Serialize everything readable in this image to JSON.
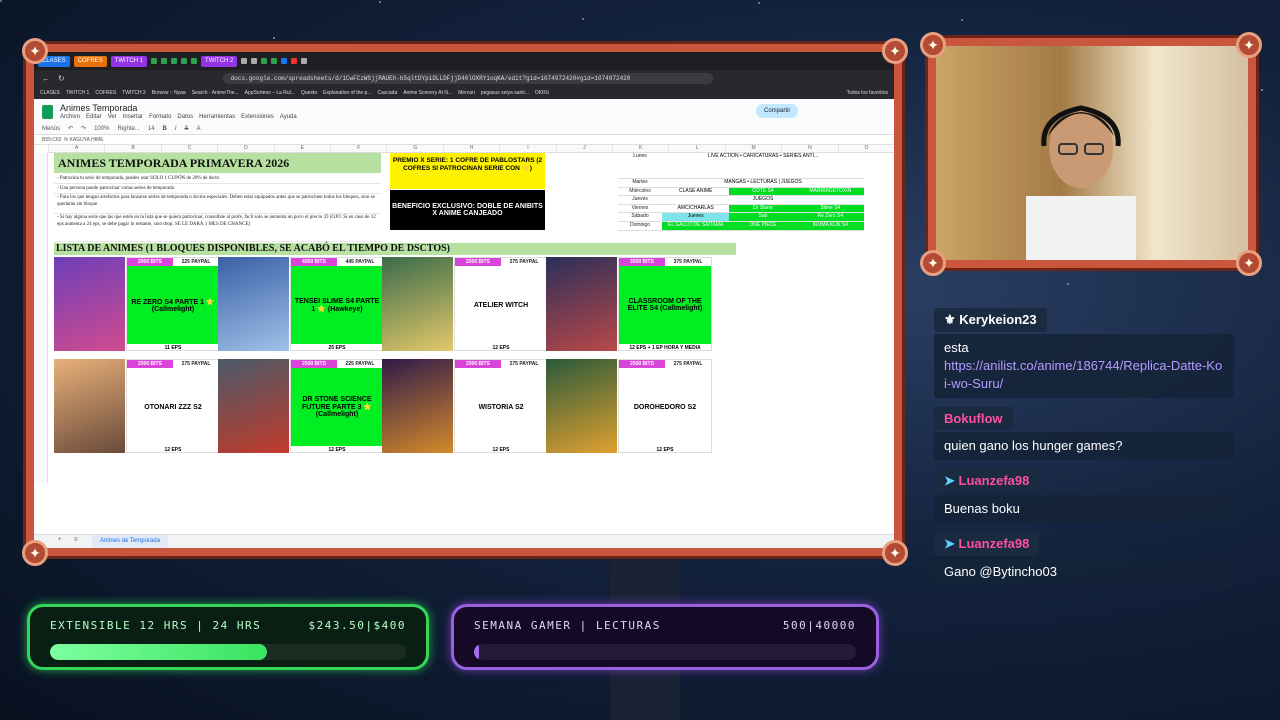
{
  "browser": {
    "tabs": [
      "CLASES",
      "COFRES",
      "TWITCH 1",
      "TWITCH 2"
    ],
    "url": "docs.google.com/spreadsheets/d/1CwFCzWSjjRAUEh-b5qltDYpiDLLDFjjD40lOXRYioqKA/edit?gid=1074972420#gid=1074972420",
    "bookmarks": [
      "CLASES",
      "TWITCH 1",
      "COFRES",
      "TWITCH 2",
      "Browse :: Nyaa",
      "Search - AnimeThe...",
      "AppSorteos – La Rul...",
      "Questo",
      "Explanation of the p...",
      "Cascada",
      "Anime Scenery At N...",
      "Mercari",
      "pegasus seiya saint...",
      "OKRU",
      "Todos los favoritos"
    ]
  },
  "sheet": {
    "doc_title": "Animes Temporada",
    "menu": [
      "Archivo",
      "Editar",
      "Ver",
      "Insertar",
      "Formato",
      "Datos",
      "Herramientas",
      "Extensiones",
      "Ayuda"
    ],
    "share_label": "Compartir",
    "toolbar": {
      "menus": "Menús",
      "zoom": "100%",
      "font": "Righte...",
      "size": "14"
    },
    "cell_ref": "B55:C62",
    "formula": "KAGUYA HIME",
    "columns": [
      "A",
      "B",
      "C",
      "D",
      "E",
      "F",
      "G",
      "H",
      "I",
      "J",
      "K",
      "L",
      "M",
      "N",
      "O"
    ],
    "title": "ANIMES TEMPORADA PRIMAVERA 2026",
    "rules": [
      "- Patrocina tu serie de temporada, puedes usar SOLO 1 CUPÓN de 20% de dscto",
      "- Una persona puede patrocinar varias series de temporada",
      "- Para los que tengan artefactos para lanzarse series de temporada o dsctos especiales. Deben estar equipados antes que se patrocinen todos los bloques, sino se quedarán sin bloque",
      "- Si hay alguna serie que las que estén en la lista que se quiera patrocinar, consultale al profe, facil solo se aumenta un poco el precio :D (OJO: Si en caso de 12 eps aumenta a 24 eps, se debe pagar lo restante, sino drop. SE LE DARÁ 1 MES DE CHANCE)"
    ],
    "premio": "PREMIO X SERIE: 1 COFRE DE PABLOSTARS (2 COFRES SI PATROCINAN SERIE CON ⭐)",
    "beneficio": "BENEFICIO EXCLUSIVO: DOBLE DE ANIBITS X ANIME CANJEADO",
    "schedule": [
      {
        "day": "Lunes",
        "cols": [
          "LIVE ACTION • CARICATURAS • SERIES ANTI..."
        ]
      },
      {
        "day": "Martes",
        "cols": [
          "MANGAS • LECTURAS | JUEGOS"
        ]
      },
      {
        "day": "Miércoles",
        "cols": [
          "CLASE ANIME",
          "COTE S4",
          "MARRIAGETOXIN"
        ]
      },
      {
        "day": "Jueves",
        "cols": [
          "JUEGOS"
        ]
      },
      {
        "day": "Viernes",
        "cols": [
          "AMC/CHARLAS",
          "Dr Stone",
          "Slime S4"
        ]
      },
      {
        "day": "Sábado",
        "cols": [
          "Jueves",
          "Sab",
          "Re Zero S4"
        ]
      },
      {
        "day": "Domingo",
        "cols": [
          "EL GALLO DE SAITAMA",
          "ONE PIECE",
          "IRUMA KUN S4"
        ]
      }
    ],
    "list_header": "LISTA DE ANIMES (1 BLOQUES DISPONIBLES, SE ACABÓ EL TIEMPO DE DSCTOS)",
    "animes": [
      {
        "bits": "2000 BITS",
        "paypal": "225 PAYPAL",
        "name": "RE ZERO S4 PARTE 1 ⭐ (Callmelight)",
        "eps": "11 EPS",
        "taken": true,
        "poster": [
          "#6d3fb8",
          "#d14b8f"
        ]
      },
      {
        "bits": "4000 BITS",
        "paypal": "445 PAYPAL",
        "name": "TENSEI SLIME S4 PARTE 1 ⭐ (Hawkeye)",
        "eps": "25 EPS",
        "taken": true,
        "poster": [
          "#3b5fa6",
          "#9fc2e8"
        ]
      },
      {
        "bits": "2500 BITS",
        "paypal": "275 PAYPAL",
        "name": "ATELIER WITCH",
        "eps": "12 EPS",
        "taken": false,
        "poster": [
          "#3a6b4a",
          "#e3c86a"
        ]
      },
      {
        "bits": "3500 BITS",
        "paypal": "375 PAYPAL",
        "name": "CLASSROOM OF THE ELITE S4 (Callmelight)",
        "eps": "12 EPS + 1 EP HORA Y MEDIA",
        "taken": true,
        "poster": [
          "#2b2f5a",
          "#b94848"
        ]
      },
      {
        "bits": "2500 BITS",
        "paypal": "275 PAYPAL",
        "name": "OTONARI ZZZ S2",
        "eps": "12 EPS",
        "taken": false,
        "poster": [
          "#e8b17a",
          "#6a4a3a"
        ]
      },
      {
        "bits": "2500 BITS",
        "paypal": "225 PAYPAL",
        "name": "DR STONE SCIENCE FUTURE PARTE 3 ⭐ (Callmelight)",
        "eps": "12 EPS",
        "taken": true,
        "poster": [
          "#4a5a6a",
          "#c23a2a"
        ]
      },
      {
        "bits": "2500 BITS",
        "paypal": "275 PAYPAL",
        "name": "WISTORIA S2",
        "eps": "12 EPS",
        "taken": false,
        "poster": [
          "#301a4a",
          "#d48a2a"
        ]
      },
      {
        "bits": "2500 BITS",
        "paypal": "275 PAYPAL",
        "name": "DOROHEDORO S2",
        "eps": "12 EPS",
        "taken": false,
        "poster": [
          "#2a5a3a",
          "#e0a030"
        ]
      }
    ],
    "tab_name": "Animes de Temporada"
  },
  "chat": [
    {
      "user": "Kerykeion23",
      "text": "esta",
      "link": "https://anilist.co/anime/186744/Replica-Datte-Koi-wo-Suru/",
      "pink": false
    },
    {
      "user": "Bokuflow",
      "text": "quien gano los hunger games?",
      "link": "",
      "pink": true
    },
    {
      "user": "Luanzefa98",
      "text": "Buenas boku",
      "link": "",
      "pink": true
    },
    {
      "user": "Luanzefa98",
      "text": "Gano @Bytincho03",
      "link": "",
      "pink": true
    }
  ],
  "goals": {
    "left": {
      "label": "EXTENSIBLE 12 HRS | 24 HRS",
      "value": "$243.50|$400",
      "progress": 0.61,
      "color": "#39e35f"
    },
    "right": {
      "label": "SEMANA GAMER | LECTURAS",
      "value": "500|40000",
      "progress": 0.0125,
      "color": "#a46cf0"
    }
  }
}
